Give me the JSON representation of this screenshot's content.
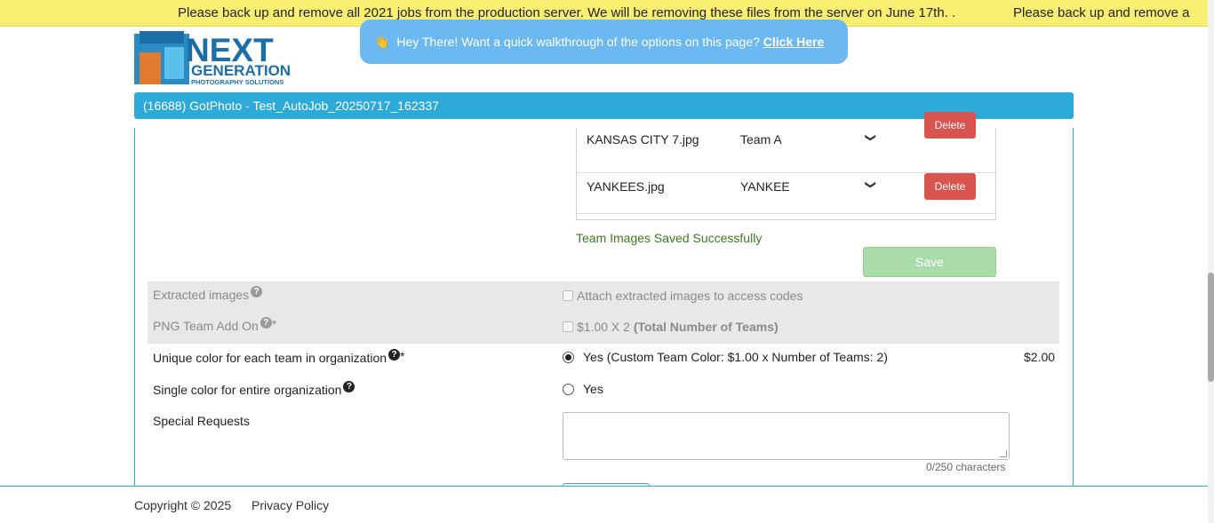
{
  "banner": {
    "message": "Please back up and remove all 2021 jobs from the production server. We will be removing these files from the server on June 17th. .",
    "message_repeat": "Please back up and remove a"
  },
  "logo": {
    "word1": "NEXT",
    "word2": "GENERATION",
    "tagline": "PHOTOGRAPHY SOLUTIONS"
  },
  "walkthrough": {
    "text": "Hey There! Want a quick walkthrough of the options on this page?",
    "link": "Click Here"
  },
  "job": {
    "title": "(16688) GotPhoto - Test_AutoJob_20250717_162337"
  },
  "team_images": {
    "rows": [
      {
        "file": "KANSAS CITY 7.jpg",
        "team": "Team A",
        "delete_label": "Delete"
      },
      {
        "file": "YANKEES.jpg",
        "team": "YANKEE",
        "delete_label": "Delete"
      }
    ],
    "status": "Team Images Saved Successfully",
    "save_label": "Save"
  },
  "options": {
    "extracted_images": {
      "label": "Extracted images",
      "checkbox_label": "Attach extracted images to access codes"
    },
    "png_team_add_on": {
      "label": "PNG Team Add On",
      "price_text": "$1.00 X 2",
      "note": "(Total Number of Teams)"
    },
    "unique_color": {
      "label": "Unique color for each team in organization",
      "option": "Yes (Custom Team Color: $1.00 x Number of Teams: 2)",
      "price": "$2.00",
      "selected": true
    },
    "single_color": {
      "label": "Single color for entire organization",
      "option": "Yes",
      "selected": false
    },
    "special_requests": {
      "label": "Special Requests",
      "value": "",
      "counter": "0/250 characters"
    }
  },
  "footer": {
    "copyright": "Copyright © 2025",
    "privacy": "Privacy Policy"
  },
  "colors": {
    "accent": "#2eaad8",
    "banner": "#f8ef71",
    "delete": "#d9534f",
    "success": "#3c7a1e",
    "save_disabled": "#a9dca8"
  }
}
